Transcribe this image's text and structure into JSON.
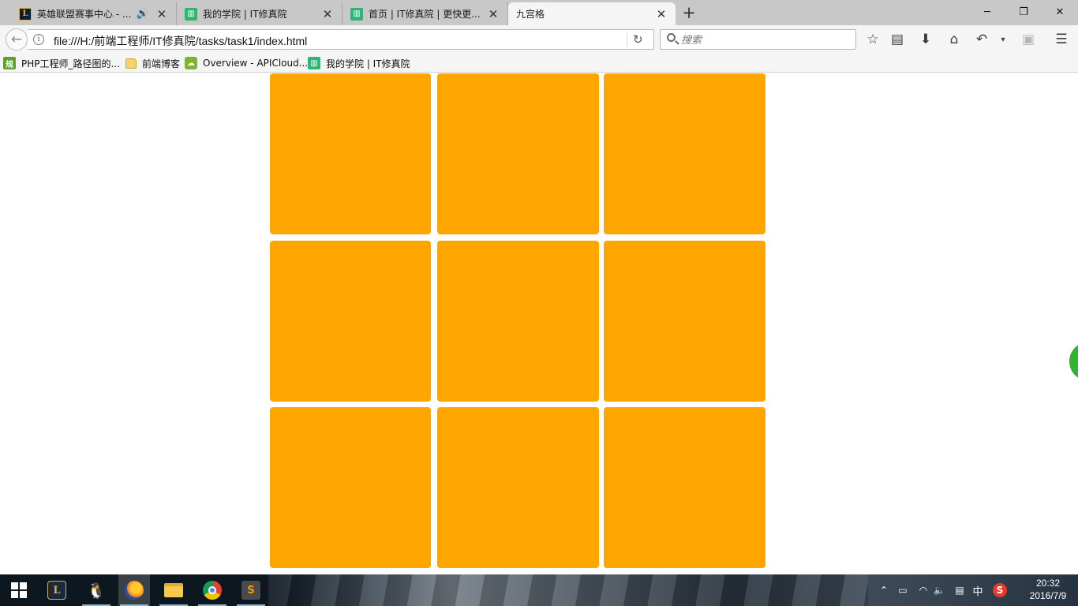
{
  "browser": {
    "tabs": [
      {
        "title": "英雄联盟赛事中心 - ...",
        "favicon": "lol-icon",
        "audio": true,
        "active": false
      },
      {
        "title": "我的学院 | IT修真院",
        "favicon": "it-academy-icon",
        "audio": false,
        "active": false
      },
      {
        "title": "首页 | IT修真院 | 更快更...",
        "favicon": "it-academy-icon",
        "audio": false,
        "active": false
      },
      {
        "title": "九宫格",
        "favicon": "none",
        "audio": false,
        "active": true
      }
    ],
    "new_tab_symbol": "+",
    "window_controls": {
      "minimize": "─",
      "restore": "❐",
      "close": "✕"
    },
    "address": "file:///H:/前端工程师/IT修真院/tasks/task1/index.html",
    "search_placeholder": "搜索",
    "toolbar_icons": [
      "star-icon",
      "reading-list-icon",
      "download-icon",
      "home-icon",
      "back-arrow-icon",
      "dropdown-icon",
      "reader-view-icon",
      "hamburger-menu-icon"
    ]
  },
  "bookmarks": [
    {
      "label": "PHP工程师_路径图的...",
      "icon": "gui-icon",
      "icon_text": "规"
    },
    {
      "label": "前端博客",
      "icon": "folder-icon",
      "icon_text": ""
    },
    {
      "label": "Overview - APICloud...",
      "icon": "apicloud-icon",
      "icon_text": ""
    },
    {
      "label": "我的学院 | IT修真院",
      "icon": "it-academy-icon",
      "icon_text": ""
    }
  ],
  "page": {
    "grid": {
      "rows": 3,
      "columns": 3,
      "cell_color": "#FFA500",
      "background": "#FFFFFF"
    }
  },
  "taskbar": {
    "apps": [
      {
        "name": "league-of-legends",
        "label": "L"
      },
      {
        "name": "qq",
        "label": "🐧"
      },
      {
        "name": "firefox",
        "label": ""
      },
      {
        "name": "file-explorer",
        "label": ""
      },
      {
        "name": "chrome",
        "label": ""
      },
      {
        "name": "sublime-text",
        "label": "S"
      }
    ],
    "ime": "中",
    "sogou": "S",
    "time": "20:32",
    "date": "2016/7/9"
  },
  "colors": {
    "accent_green": "#2BB673",
    "grid_orange": "#FFA500"
  }
}
